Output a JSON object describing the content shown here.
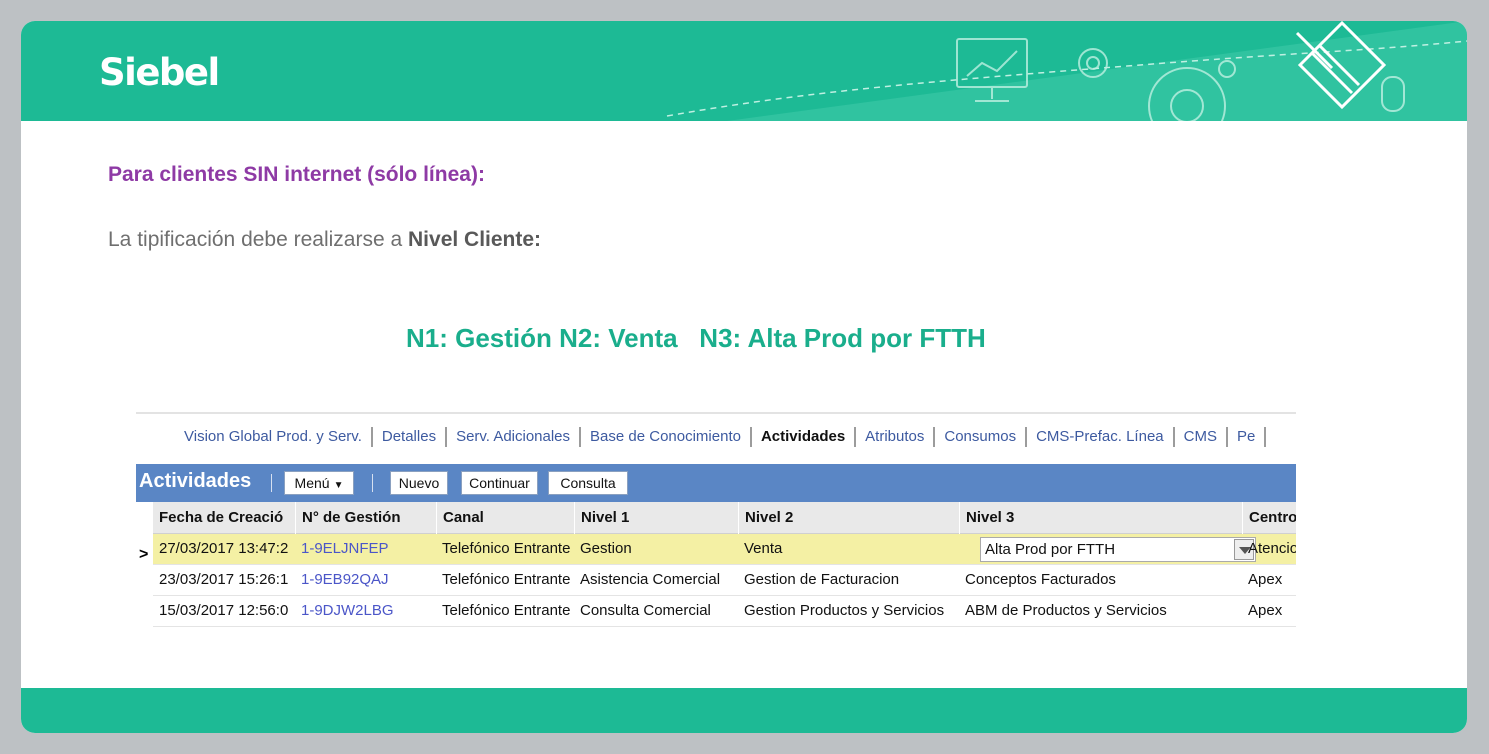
{
  "brand": {
    "logo": "Siebel"
  },
  "slide": {
    "heading": "Para clientes SIN internet (sólo línea):",
    "paragraph_prefix": "La tipificación debe realizarse a ",
    "paragraph_bold": "Nivel Cliente:",
    "levels": "N1: Gestión N2: Venta   N3: Alta Prod por FTTH"
  },
  "colors": {
    "accent": "#1dba95",
    "heading": "#8e3aa5",
    "levels": "#1aae8c",
    "app_header": "#5a86c5",
    "selected_row": "#f4f0a4"
  },
  "siebel": {
    "tabs": [
      {
        "label": "Vision Global Prod. y Serv.",
        "active": false
      },
      {
        "label": "Detalles",
        "active": false
      },
      {
        "label": "Serv. Adicionales",
        "active": false
      },
      {
        "label": "Base de Conocimiento",
        "active": false
      },
      {
        "label": "Actividades",
        "active": true
      },
      {
        "label": "Atributos",
        "active": false
      },
      {
        "label": "Consumos",
        "active": false
      },
      {
        "label": "CMS-Prefac. Línea",
        "active": false
      },
      {
        "label": "CMS",
        "active": false
      },
      {
        "label": "Pe",
        "active": false
      }
    ],
    "applet_title": "Actividades",
    "menu_label": "Menú",
    "buttons": {
      "new": "Nuevo",
      "continue": "Continuar",
      "query": "Consulta"
    },
    "columns": [
      "Fecha de Creació",
      "N° de Gestión",
      "Canal",
      "Nivel 1",
      "Nivel 2",
      "Nivel 3",
      "Centro"
    ],
    "rows": [
      {
        "fecha": "27/03/2017 13:47:2",
        "gestion": "1-9ELJNFEP",
        "canal": "Telefónico Entrante",
        "nivel1": "Gestion",
        "nivel2": "Venta",
        "nivel3": "Alta Prod por FTTH",
        "centro": "Atencio"
      },
      {
        "fecha": "23/03/2017 15:26:1",
        "gestion": "1-9EB92QAJ",
        "canal": "Telefónico Entrante",
        "nivel1": "Asistencia Comercial",
        "nivel2": "Gestion de Facturacion",
        "nivel3": "Conceptos Facturados",
        "centro": "Apex"
      },
      {
        "fecha": "15/03/2017 12:56:0",
        "gestion": "1-9DJW2LBG",
        "canal": "Telefónico Entrante",
        "nivel1": "Consulta Comercial",
        "nivel2": "Gestion Productos y Servicios",
        "nivel3": "ABM de Productos y Servicios",
        "centro": "Apex"
      }
    ],
    "selected_row_marker": ">"
  }
}
